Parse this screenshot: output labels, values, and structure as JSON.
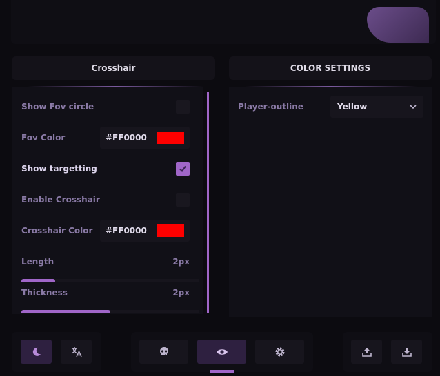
{
  "crosshair_panel": {
    "title": "Crosshair",
    "rows": [
      {
        "label": "Show Fov circle",
        "type": "checkbox",
        "checked": false
      },
      {
        "label": "Fov Color",
        "type": "color",
        "value": "#FF0000",
        "swatch": "#FF0000"
      },
      {
        "label": "Show targetting",
        "type": "checkbox",
        "checked": true
      },
      {
        "label": "Enable Crosshair",
        "type": "checkbox",
        "checked": false
      },
      {
        "label": "Crosshair Color",
        "type": "color",
        "value": "#FF0000",
        "swatch": "#FF0000"
      },
      {
        "label": "Length",
        "type": "slider",
        "value": "2px",
        "fill_fraction": 0.19
      },
      {
        "label": "Thickness",
        "type": "slider",
        "value": "2px",
        "fill_fraction": 0.5
      }
    ]
  },
  "color_panel": {
    "title": "COLOR SETTINGS",
    "player_outline_label": "Player-outline",
    "player_outline_value": "Yellow"
  },
  "footer": {
    "left_buttons": [
      "moon-icon",
      "translate-icon"
    ],
    "center_buttons": [
      "skull-icon",
      "eye-icon",
      "gear-icon"
    ],
    "active_tab": "eye-icon",
    "right_buttons": [
      "upload-icon",
      "download-icon"
    ]
  },
  "colors": {
    "accent": "#A066C8",
    "background": "#0C0B10",
    "panel": "#111017"
  }
}
